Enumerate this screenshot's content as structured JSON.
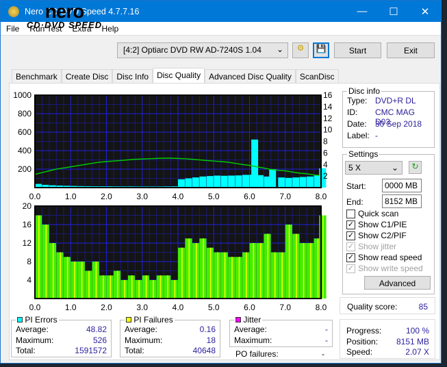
{
  "window": {
    "title": "Nero CD-DVD Speed 4.7.7.16"
  },
  "menu": [
    "File",
    "Run Test",
    "Extra",
    "Help"
  ],
  "logo": {
    "line1": "nero",
    "line2": "CD·DVD SPEED"
  },
  "toolbar": {
    "drive": "[4:2]  Optiarc DVD RW AD-7240S 1.04",
    "start": "Start",
    "exit": "Exit"
  },
  "tabs": [
    "Benchmark",
    "Create Disc",
    "Disc Info",
    "Disc Quality",
    "Advanced Disc Quality",
    "ScanDisc"
  ],
  "active_tab": "Disc Quality",
  "disc_info": {
    "title": "Disc info",
    "type_label": "Type:",
    "type": "DVD+R DL",
    "id_label": "ID:",
    "id": "CMC MAG D03",
    "date_label": "Date:",
    "date": "30 Sep 2018",
    "label_label": "Label:",
    "label": "-"
  },
  "settings": {
    "title": "Settings",
    "speed": "5 X",
    "start_label": "Start:",
    "start": "0000 MB",
    "end_label": "End:",
    "end": "8152 MB",
    "checks": [
      {
        "label": "Quick scan",
        "checked": false,
        "enabled": true
      },
      {
        "label": "Show C1/PIE",
        "checked": true,
        "enabled": true
      },
      {
        "label": "Show C2/PIF",
        "checked": true,
        "enabled": true
      },
      {
        "label": "Show jitter",
        "checked": true,
        "enabled": false
      },
      {
        "label": "Show read speed",
        "checked": true,
        "enabled": true
      },
      {
        "label": "Show write speed",
        "checked": true,
        "enabled": false
      }
    ],
    "advanced": "Advanced"
  },
  "quality": {
    "label": "Quality score:",
    "value": "85"
  },
  "pi_errors": {
    "title": "PI Errors",
    "color": "#00ffff",
    "average_label": "Average:",
    "average": "48.82",
    "maximum_label": "Maximum:",
    "maximum": "526",
    "total_label": "Total:",
    "total": "1591572"
  },
  "pi_failures": {
    "title": "PI Failures",
    "color": "#ffff00",
    "average_label": "Average:",
    "average": "0.16",
    "maximum_label": "Maximum:",
    "maximum": "18",
    "total_label": "Total:",
    "total": "40648"
  },
  "jitter": {
    "title": "Jitter",
    "color": "#ff00ff",
    "average_label": "Average:",
    "average": "-",
    "maximum_label": "Maximum:",
    "maximum": "-",
    "po_label": "PO failures:",
    "po": "-"
  },
  "progress": {
    "progress_label": "Progress:",
    "progress": "100 %",
    "position_label": "Position:",
    "position": "8151 MB",
    "speed_label": "Speed:",
    "speed": "2.07 X"
  },
  "chart_data": [
    {
      "type": "bar",
      "title": "",
      "xlim": [
        0,
        8
      ],
      "ylim": [
        0,
        1000
      ],
      "y2lim": [
        0,
        16
      ],
      "xticks": [
        "0.0",
        "1.0",
        "2.0",
        "3.0",
        "4.0",
        "5.0",
        "6.0",
        "7.0",
        "8.0"
      ],
      "yticks": [
        "200",
        "400",
        "600",
        "800",
        "1000"
      ],
      "y2ticks": [
        "2",
        "4",
        "6",
        "8",
        "10",
        "12",
        "14",
        "16"
      ],
      "x": [
        0,
        0.2,
        0.4,
        0.6,
        0.8,
        1.0,
        1.2,
        1.4,
        1.6,
        1.8,
        2.0,
        2.2,
        2.4,
        2.6,
        2.8,
        3.0,
        3.2,
        3.4,
        3.6,
        3.8,
        4.0,
        4.2,
        4.4,
        4.6,
        4.8,
        5.0,
        5.2,
        5.4,
        5.6,
        5.8,
        6.0,
        6.05,
        6.2,
        6.4,
        6.55,
        6.8,
        7.0,
        7.2,
        7.4,
        7.6,
        7.8,
        7.95
      ],
      "series": [
        {
          "name": "PI Errors",
          "color": "#00ffff",
          "values": [
            40,
            30,
            25,
            22,
            20,
            18,
            16,
            15,
            14,
            14,
            14,
            13,
            13,
            13,
            12,
            12,
            12,
            12,
            13,
            14,
            90,
            100,
            110,
            120,
            125,
            130,
            128,
            130,
            132,
            138,
            140,
            520,
            135,
            120,
            200,
            110,
            105,
            110,
            115,
            120,
            130,
            210
          ]
        },
        {
          "name": "Read speed",
          "color": "#00cc00",
          "axis": "right",
          "values": [
            2.3,
            2.6,
            2.9,
            3.2,
            3.4,
            3.6,
            3.8,
            4.0,
            4.2,
            4.4,
            4.5,
            4.6,
            4.7,
            4.8,
            4.9,
            4.95,
            5.0,
            5.05,
            5.1,
            5.1,
            5.05,
            5.0,
            4.9,
            4.8,
            4.7,
            4.6,
            4.5,
            4.4,
            4.2,
            4.0,
            3.85,
            3.8,
            3.6,
            3.4,
            3.2,
            3.0,
            2.9,
            2.7,
            2.5,
            2.4,
            2.2,
            2.1
          ]
        }
      ]
    },
    {
      "type": "bar",
      "title": "",
      "xlim": [
        0,
        8
      ],
      "ylim": [
        0,
        20
      ],
      "xticks": [
        "0.0",
        "1.0",
        "2.0",
        "3.0",
        "4.0",
        "5.0",
        "6.0",
        "7.0",
        "8.0"
      ],
      "yticks": [
        "4",
        "8",
        "12",
        "16",
        "20"
      ],
      "x": [
        0,
        0.2,
        0.4,
        0.6,
        0.8,
        1.0,
        1.2,
        1.4,
        1.6,
        1.8,
        2.0,
        2.2,
        2.4,
        2.6,
        2.8,
        3.0,
        3.2,
        3.4,
        3.6,
        3.8,
        4.0,
        4.2,
        4.4,
        4.6,
        4.8,
        5.0,
        5.2,
        5.4,
        5.6,
        5.8,
        6.0,
        6.2,
        6.4,
        6.6,
        6.8,
        7.0,
        7.2,
        7.4,
        7.6,
        7.8,
        7.95
      ],
      "series": [
        {
          "name": "PI Failures",
          "color": "#ffff00",
          "values": [
            18,
            16,
            12,
            10,
            9,
            8,
            8,
            6,
            8,
            5,
            5,
            6,
            4,
            5,
            4,
            5,
            4,
            5,
            5,
            4,
            11,
            13,
            12,
            13,
            11,
            10,
            10,
            9,
            9,
            10,
            12,
            12,
            14,
            10,
            10,
            16,
            14,
            12,
            12,
            13,
            18
          ]
        }
      ]
    }
  ]
}
